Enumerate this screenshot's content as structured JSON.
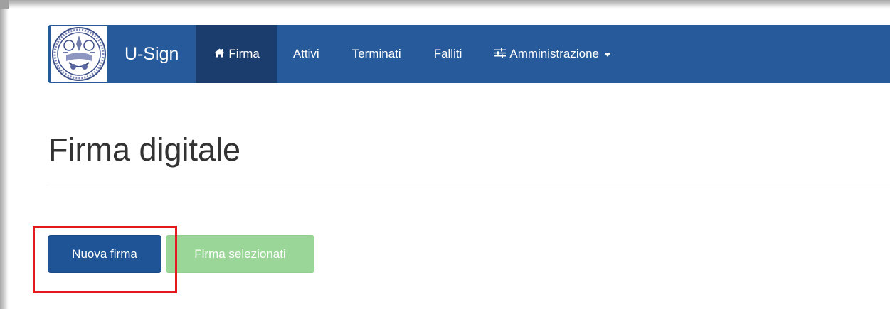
{
  "navbar": {
    "brand": "U-Sign",
    "items": [
      {
        "label": "Firma",
        "icon": "home-icon",
        "active": true
      },
      {
        "label": "Attivi"
      },
      {
        "label": "Terminati"
      },
      {
        "label": "Falliti"
      },
      {
        "label": "Amministrazione",
        "icon": "sliders-icon",
        "dropdown": true
      }
    ],
    "colors": {
      "background": "#265a9b",
      "active": "#1b3d6d"
    }
  },
  "page": {
    "title": "Firma digitale"
  },
  "actions": {
    "new_signature": "Nuova firma",
    "sign_selected": "Firma selezionati",
    "sign_selected_disabled": true,
    "colors": {
      "primary": "#1f5596",
      "success_disabled": "#9bd699",
      "highlight": "#e3191f"
    }
  }
}
